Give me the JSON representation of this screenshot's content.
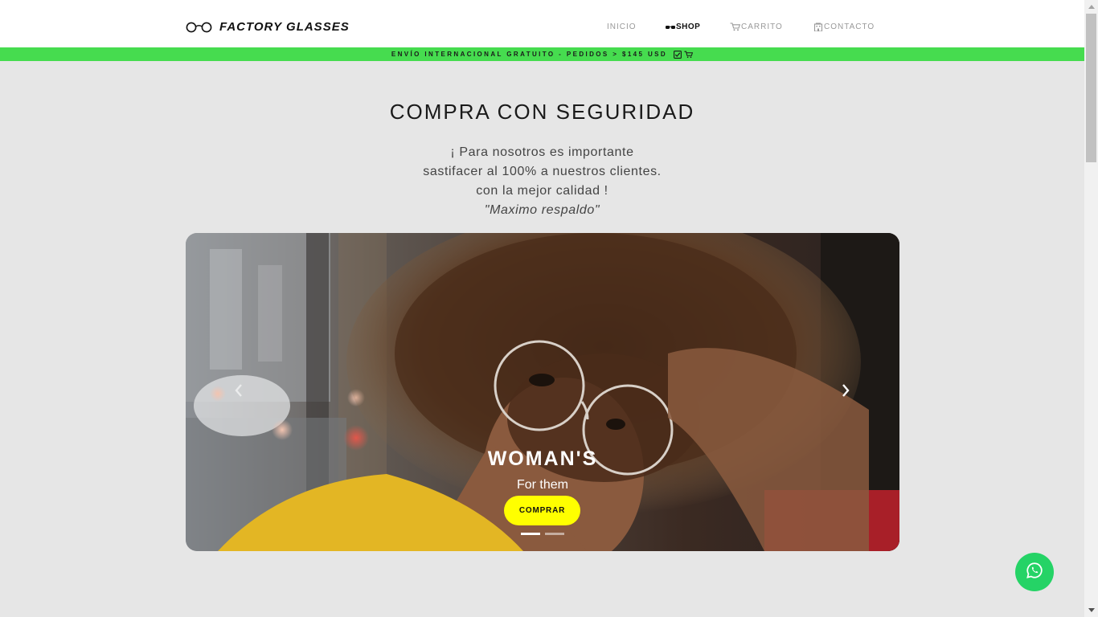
{
  "brand": {
    "name": "FACTORY GLASSES",
    "icon": "glasses-icon"
  },
  "nav": {
    "items": [
      {
        "label": "INICIO",
        "icon": ""
      },
      {
        "label": "SHOP",
        "icon": "sunglasses-icon",
        "active": true
      },
      {
        "label": "CARRITO",
        "icon": "cart-icon"
      },
      {
        "label": "CONTACTO",
        "icon": "building-icon"
      }
    ]
  },
  "promo": {
    "text": "ENVÍO INTERNACIONAL GRATUITO - PEDIDOS > $145 USD",
    "icons": [
      "check-box-icon",
      "cart-icon"
    ],
    "color": "#46dc4f"
  },
  "hero": {
    "title": "COMPRA CON SEGURIDAD",
    "lines": [
      "¡ Para nosotros es importante",
      "sastifacer al 100% a nuestros clientes.",
      "con la mejor calidad !"
    ],
    "quote": "\"Maximo respaldo\""
  },
  "carousel": {
    "slide_title": "WOMAN'S",
    "slide_subtitle": "For them",
    "button_label": "COMPRAR",
    "button_color": "#ffff00",
    "slide_count": 2,
    "active_index": 0
  },
  "whatsapp": {
    "icon": "whatsapp-icon",
    "color": "#25d366"
  }
}
